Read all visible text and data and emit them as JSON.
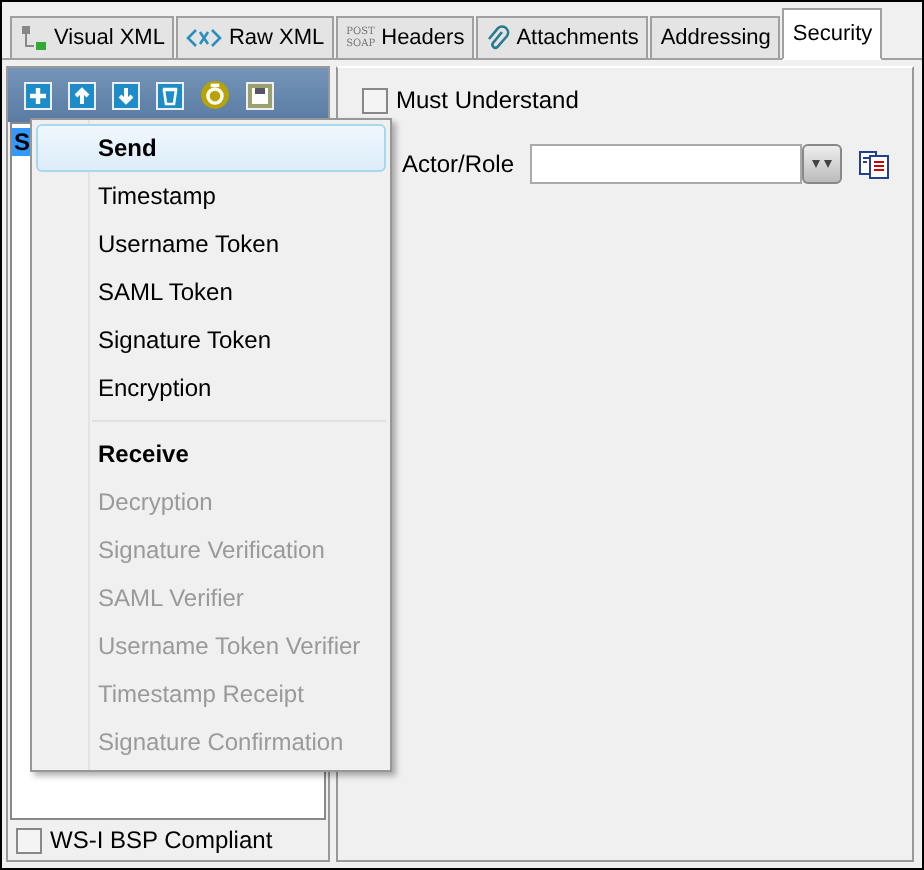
{
  "tabs": [
    {
      "label": "Visual XML",
      "selected": false
    },
    {
      "label": "Raw XML",
      "selected": false
    },
    {
      "label": "Headers",
      "icon_text": [
        "POST",
        "SOAP"
      ],
      "selected": false
    },
    {
      "label": "Attachments",
      "selected": false
    },
    {
      "label": "Addressing",
      "selected": false
    },
    {
      "label": "Security",
      "selected": true
    }
  ],
  "list": {
    "items": [
      {
        "label": "S",
        "selected": true
      }
    ]
  },
  "wsi_checkbox": {
    "label": "WS-I BSP Compliant",
    "checked": false
  },
  "must_understand": {
    "label": "Must Understand",
    "checked": false
  },
  "actor_role": {
    "label": "Actor/Role"
  },
  "menu": {
    "items": [
      {
        "kind": "header",
        "label": "Send",
        "selected": true,
        "disabled": false
      },
      {
        "kind": "item",
        "label": "Timestamp",
        "selected": false,
        "disabled": false
      },
      {
        "kind": "item",
        "label": "Username Token",
        "selected": false,
        "disabled": false
      },
      {
        "kind": "item",
        "label": "SAML Token",
        "selected": false,
        "disabled": false
      },
      {
        "kind": "item",
        "label": "Signature Token",
        "selected": false,
        "disabled": false
      },
      {
        "kind": "item",
        "label": "Encryption",
        "selected": false,
        "disabled": false
      },
      {
        "kind": "separator"
      },
      {
        "kind": "header",
        "label": "Receive",
        "selected": false,
        "disabled": false
      },
      {
        "kind": "item",
        "label": "Decryption",
        "selected": false,
        "disabled": true
      },
      {
        "kind": "item",
        "label": "Signature Verification",
        "selected": false,
        "disabled": true
      },
      {
        "kind": "item",
        "label": "SAML Verifier",
        "selected": false,
        "disabled": true
      },
      {
        "kind": "item",
        "label": "Username Token Verifier",
        "selected": false,
        "disabled": true
      },
      {
        "kind": "item",
        "label": "Timestamp Receipt",
        "selected": false,
        "disabled": true
      },
      {
        "kind": "item",
        "label": "Signature Confirmation",
        "selected": false,
        "disabled": true
      }
    ]
  }
}
